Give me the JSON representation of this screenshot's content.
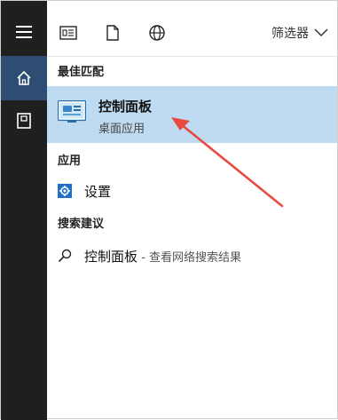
{
  "topbar": {
    "filter_label": "筛选器",
    "icons": [
      "document-icon",
      "file-icon",
      "globe-icon"
    ]
  },
  "rail": {
    "icons": [
      "hamburger-menu-icon",
      "home-icon",
      "notebook-icon"
    ],
    "active_color": "#2d4e72"
  },
  "best_match": {
    "title": "最佳匹配",
    "item_name": "控制面板",
    "item_type": "桌面应用"
  },
  "apps": {
    "title": "应用",
    "items": [
      {
        "label": "设置",
        "icon": "gear-icon"
      }
    ]
  },
  "suggestions": {
    "title": "搜索建议",
    "items": [
      {
        "label": "控制面板",
        "hint": " - 查看网络搜索结果",
        "icon": "search-icon"
      }
    ]
  },
  "annotation": {
    "color": "#e84a3f"
  }
}
